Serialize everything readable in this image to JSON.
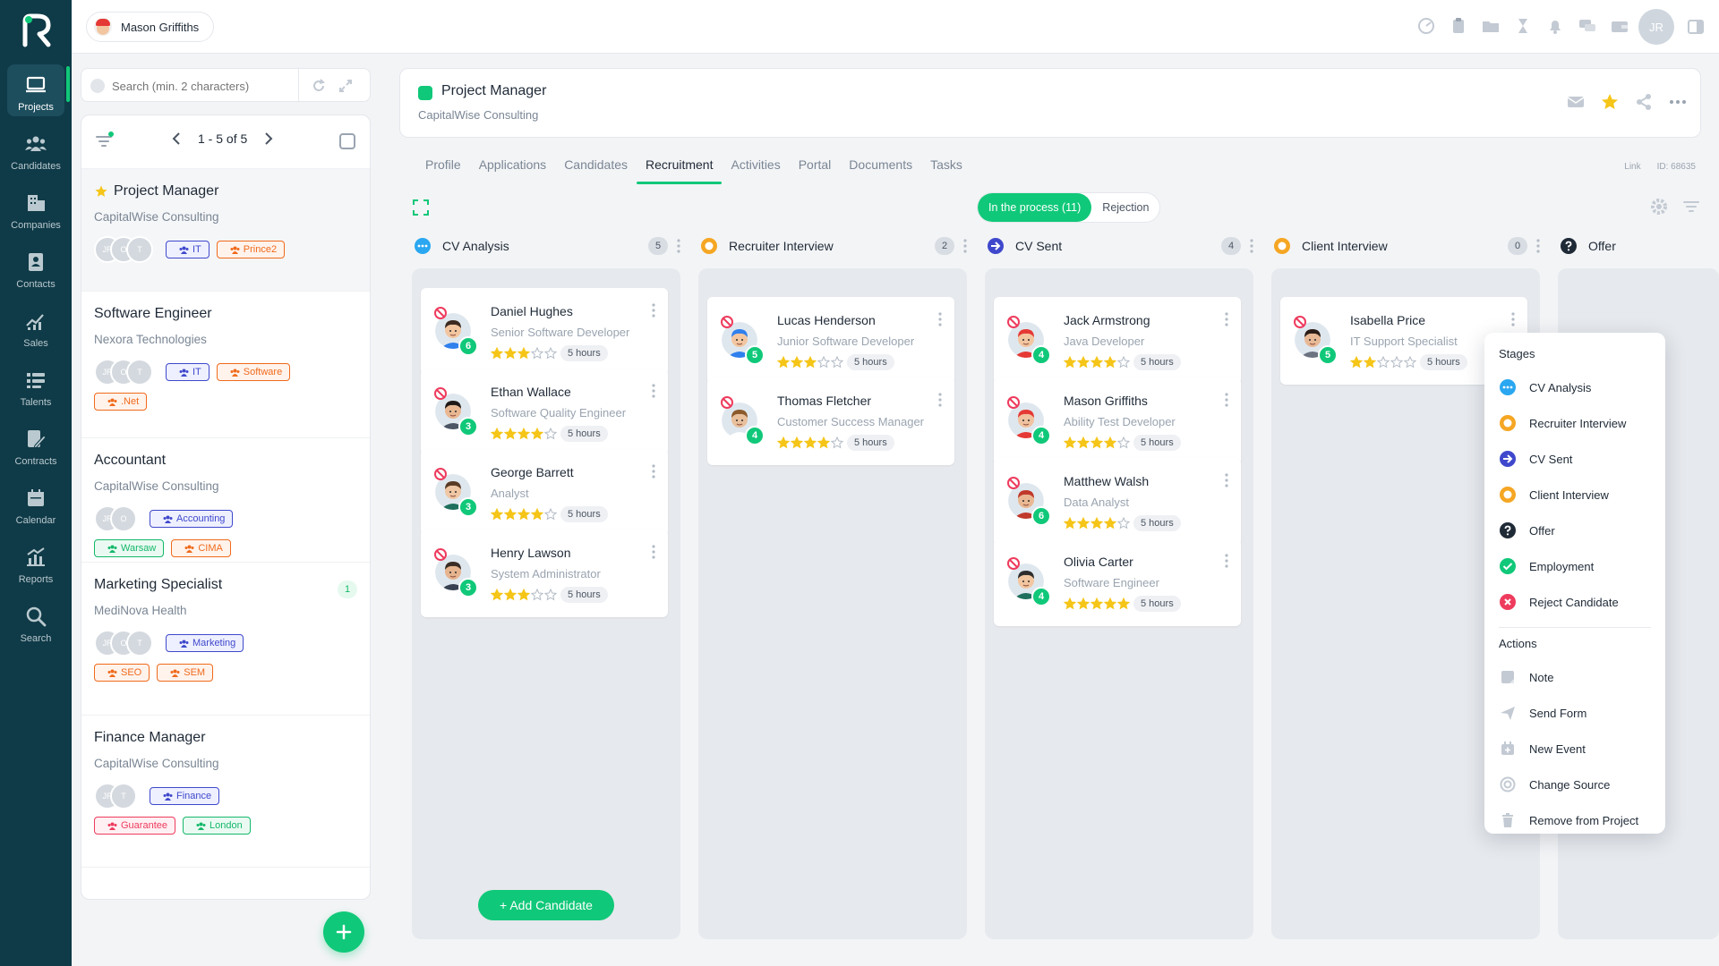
{
  "user_chip": {
    "name": "Mason Griffiths"
  },
  "top_avatar": {
    "initials": "JR"
  },
  "nav": [
    {
      "label": "Projects",
      "icon": "laptop-icon",
      "active": true
    },
    {
      "label": "Candidates",
      "icon": "people-icon"
    },
    {
      "label": "Companies",
      "icon": "building-icon"
    },
    {
      "label": "Contacts",
      "icon": "contact-card-icon"
    },
    {
      "label": "Sales",
      "icon": "sales-chart-icon"
    },
    {
      "label": "Talents",
      "icon": "talents-list-icon"
    },
    {
      "label": "Contracts",
      "icon": "contract-pen-icon"
    },
    {
      "label": "Calendar",
      "icon": "calendar-icon"
    },
    {
      "label": "Reports",
      "icon": "reports-chart-icon"
    },
    {
      "label": "Search",
      "icon": "search-icon"
    }
  ],
  "search": {
    "placeholder": "Search (min. 2 characters)"
  },
  "pager": {
    "text": "1 - 5 of 5"
  },
  "projects": [
    {
      "title": "Project Manager",
      "company": "CapitalWise Consulting",
      "starred": true,
      "avatars": [
        "JR",
        "O",
        "T"
      ],
      "tags_row1": [
        {
          "label": "IT",
          "color": "blue"
        },
        {
          "label": "Prince2",
          "color": "orange"
        }
      ],
      "tags_row2": []
    },
    {
      "title": "Software Engineer",
      "company": "Nexora Technologies",
      "avatars": [
        "JR",
        "O",
        "T"
      ],
      "tags_row1": [
        {
          "label": "IT",
          "color": "blue"
        },
        {
          "label": "Software",
          "color": "orange"
        }
      ],
      "tags_row2": [
        {
          "label": ".Net",
          "color": "orange"
        }
      ]
    },
    {
      "title": "Accountant",
      "company": "CapitalWise Consulting",
      "avatars": [
        "JR",
        "O"
      ],
      "tags_row1": [
        {
          "label": "Accounting",
          "color": "blue"
        }
      ],
      "tags_row2": [
        {
          "label": "Warsaw",
          "color": "green"
        },
        {
          "label": "CIMA",
          "color": "orange"
        }
      ]
    },
    {
      "title": "Marketing Specialist",
      "company": "MediNova Health",
      "badge": "1",
      "avatars": [
        "JR",
        "O",
        "T"
      ],
      "tags_row1": [
        {
          "label": "Marketing",
          "color": "blue"
        }
      ],
      "tags_row2": [
        {
          "label": "SEO",
          "color": "orange"
        },
        {
          "label": "SEM",
          "color": "orange"
        }
      ]
    },
    {
      "title": "Finance Manager",
      "company": "CapitalWise Consulting",
      "avatars": [
        "JR",
        "T"
      ],
      "tags_row1": [
        {
          "label": "Finance",
          "color": "blue"
        }
      ],
      "tags_row2": [
        {
          "label": "Guarantee",
          "color": "red"
        },
        {
          "label": "London",
          "color": "green"
        }
      ]
    }
  ],
  "header": {
    "title": "Project Manager",
    "company": "CapitalWise Consulting"
  },
  "tabs": [
    "Profile",
    "Applications",
    "Candidates",
    "Recruitment",
    "Activities",
    "Portal",
    "Documents",
    "Tasks"
  ],
  "active_tab": "Recruitment",
  "meta": {
    "link": "Link",
    "id": "ID: 68635"
  },
  "segment": {
    "in_process": "In the process (11)",
    "rejection": "Rejection"
  },
  "columns": [
    {
      "name": "CV Analysis",
      "count": "5",
      "color": "#2aa7f0",
      "icon": "dots-icon",
      "cards": [
        {
          "name": "Daniel Hughes",
          "role": "Senior Software Developer",
          "rating": 3,
          "hours": "5 hours",
          "num": "6",
          "skin": "#f2c6a0",
          "hair": "#3b2a20",
          "shirt": "#2f80ed"
        },
        {
          "name": "Ethan Wallace",
          "role": "Software Quality Engineer",
          "rating": 4,
          "hours": "5 hours",
          "num": "3",
          "skin": "#e9b893",
          "hair": "#1f1a17",
          "shirt": "#4b5563"
        },
        {
          "name": "George Barrett",
          "role": "Analyst",
          "rating": 4,
          "hours": "5 hours",
          "num": "3",
          "skin": "#f0c7a4",
          "hair": "#5a3b26",
          "shirt": "#1e6f5c"
        },
        {
          "name": "Henry Lawson",
          "role": "System Administrator",
          "rating": 3,
          "hours": "5 hours",
          "num": "3",
          "skin": "#e6b48e",
          "hair": "#3a2d25",
          "shirt": "#374151"
        }
      ]
    },
    {
      "name": "Recruiter Interview",
      "count": "2",
      "color": "#f5a623",
      "icon": "ring-icon",
      "cards": [
        {
          "name": "Lucas Henderson",
          "role": "Junior Software Developer",
          "rating": 3,
          "hours": "5 hours",
          "num": "5",
          "skin": "#f2c6a0",
          "hair": "#2f80ed",
          "shirt": "#2f80ed"
        },
        {
          "name": "Thomas Fletcher",
          "role": "Customer Success Manager",
          "rating": 4,
          "hours": "5 hours",
          "num": "4",
          "skin": "#e8c09c",
          "hair": "#8b5a2b",
          "shirt": "#fff"
        }
      ]
    },
    {
      "name": "CV Sent",
      "count": "4",
      "color": "#3f48cc",
      "icon": "arrow-right-icon",
      "cards": [
        {
          "name": "Jack Armstrong",
          "role": "Java Developer",
          "rating": 4,
          "hours": "5 hours",
          "num": "4",
          "skin": "#f2c6a0",
          "hair": "#e53935",
          "shirt": "#e53935"
        },
        {
          "name": "Mason Griffiths",
          "role": "Ability Test Developer",
          "rating": 4,
          "hours": "5 hours",
          "num": "4",
          "skin": "#f0c29f",
          "hair": "#e53935",
          "shirt": "#e53935"
        },
        {
          "name": "Matthew Walsh",
          "role": "Data Analyst",
          "rating": 4,
          "hours": "5 hours",
          "num": "6",
          "skin": "#e9b893",
          "hair": "#c0392b",
          "shirt": "#c0392b"
        },
        {
          "name": "Olivia Carter",
          "role": "Software Engineer",
          "rating": 5,
          "hours": "5 hours",
          "num": "4",
          "skin": "#f2c6a0",
          "hair": "#2d2d2d",
          "shirt": "#1e6f5c"
        }
      ]
    },
    {
      "name": "Client Interview",
      "count": "0",
      "color": "#f5a623",
      "icon": "ring-icon",
      "cards": [
        {
          "name": "Isabella Price",
          "role": "IT Support Specialist",
          "rating": 2,
          "hours": "5 hours",
          "num": "5",
          "skin": "#e8b996",
          "hair": "#2b1d16",
          "shirt": "#6b7280"
        }
      ]
    },
    {
      "name": "Offer",
      "count": "",
      "color": "#1f2a37",
      "icon": "question-icon",
      "cards": []
    }
  ],
  "add_candidate": "+ Add Candidate",
  "menu": {
    "stages_title": "Stages",
    "stages": [
      {
        "label": "CV Analysis",
        "color": "#2aa7f0",
        "icon": "dots-icon"
      },
      {
        "label": "Recruiter Interview",
        "color": "#f5a623",
        "icon": "ring-icon"
      },
      {
        "label": "CV Sent",
        "color": "#3f48cc",
        "icon": "arrow-right-icon"
      },
      {
        "label": "Client Interview",
        "color": "#f5a623",
        "icon": "ring-icon"
      },
      {
        "label": "Offer",
        "color": "#1f2a37",
        "icon": "question-icon"
      },
      {
        "label": "Employment",
        "color": "#10c879",
        "icon": "check-icon"
      },
      {
        "label": "Reject Candidate",
        "color": "#ee3b5d",
        "icon": "x-icon"
      }
    ],
    "actions_title": "Actions",
    "actions": [
      {
        "label": "Note",
        "icon": "note-icon"
      },
      {
        "label": "Send Form",
        "icon": "send-icon"
      },
      {
        "label": "New Event",
        "icon": "calendar-plus-icon"
      },
      {
        "label": "Change Source",
        "icon": "target-icon"
      },
      {
        "label": "Remove from Project",
        "icon": "trash-icon"
      }
    ]
  },
  "colors": {
    "accent": "#10c879",
    "nav_bg": "#0f3a47",
    "star": "#f5c518"
  }
}
